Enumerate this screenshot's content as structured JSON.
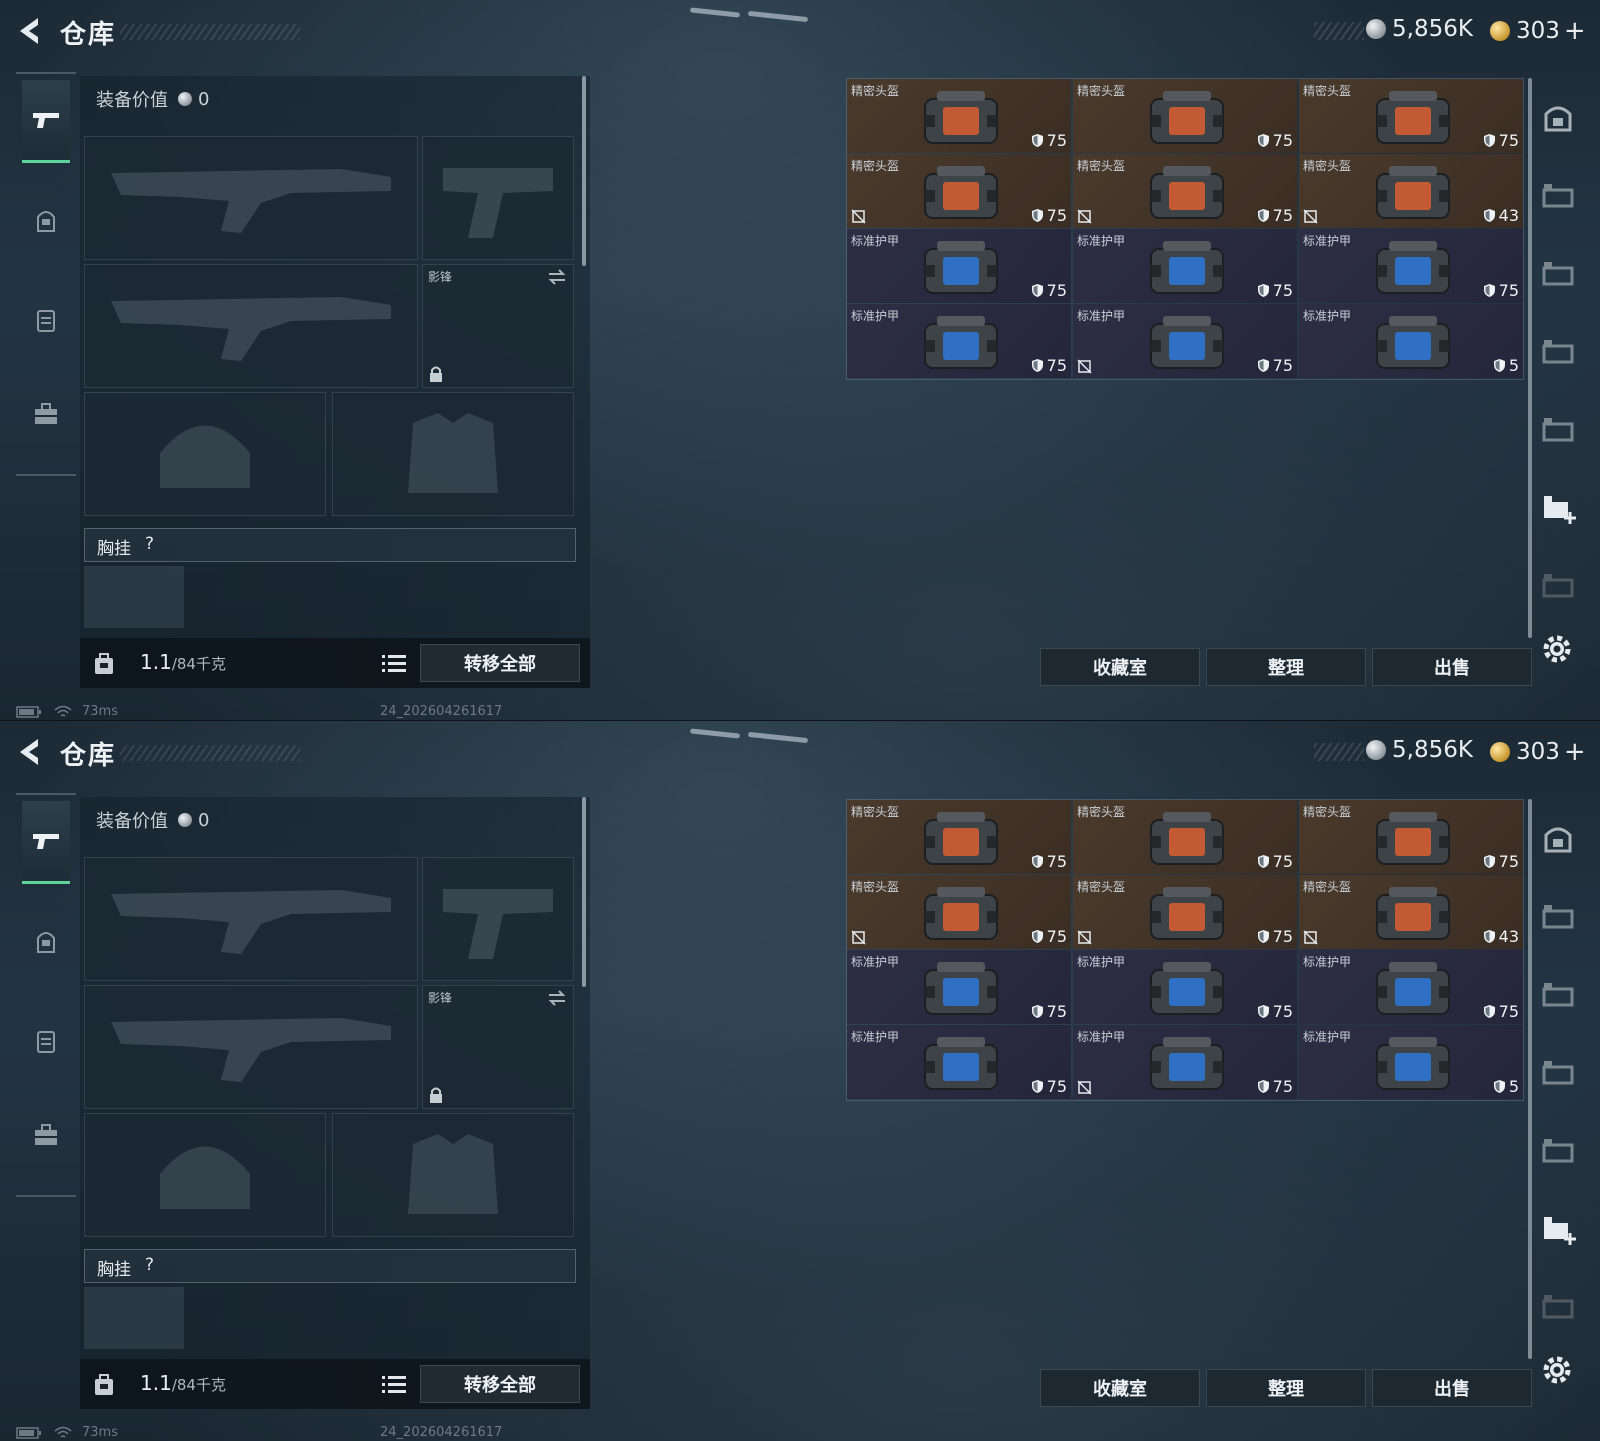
{
  "screens": [
    {
      "title": "仓库",
      "currency": {
        "silver": "5,856K",
        "gold": "303",
        "gold_plus": "+"
      },
      "equip": {
        "value_label": "装备价值",
        "value": "0",
        "slot_secondary_label": "影锋",
        "chest_label": "胸挂",
        "chest_help": "?",
        "weight_current": "1.1",
        "weight_max": "/84千克",
        "transfer_all": "转移全部"
      },
      "items": [
        {
          "name": "精密头盔",
          "value": "75",
          "type": "helmet",
          "flag": false
        },
        {
          "name": "精密头盔",
          "value": "75",
          "type": "helmet",
          "flag": false
        },
        {
          "name": "精密头盔",
          "value": "75",
          "type": "helmet",
          "flag": false
        },
        {
          "name": "精密头盔",
          "value": "75",
          "type": "helmet",
          "flag": true
        },
        {
          "name": "精密头盔",
          "value": "75",
          "type": "helmet",
          "flag": true
        },
        {
          "name": "精密头盔",
          "value": "43",
          "type": "helmet",
          "flag": true
        },
        {
          "name": "标准护甲",
          "value": "75",
          "type": "armor",
          "flag": false
        },
        {
          "name": "标准护甲",
          "value": "75",
          "type": "armor",
          "flag": false
        },
        {
          "name": "标准护甲",
          "value": "75",
          "type": "armor",
          "flag": false
        },
        {
          "name": "标准护甲",
          "value": "75",
          "type": "armor",
          "flag": false
        },
        {
          "name": "标准护甲",
          "value": "75",
          "type": "armor",
          "flag": true
        },
        {
          "name": "标准护甲",
          "value": "5",
          "type": "armor",
          "flag": false
        }
      ],
      "actions": {
        "collection": "收藏室",
        "sort": "整理",
        "sell": "出售"
      },
      "status": {
        "ping": "73ms",
        "build": "24_202604261617"
      }
    },
    {
      "title": "仓库",
      "currency": {
        "silver": "5,856K",
        "gold": "303",
        "gold_plus": "+"
      },
      "equip": {
        "value_label": "装备价值",
        "value": "0",
        "slot_secondary_label": "影锋",
        "chest_label": "胸挂",
        "chest_help": "?",
        "weight_current": "1.1",
        "weight_max": "/84千克",
        "transfer_all": "转移全部"
      },
      "items": [
        {
          "name": "精密头盔",
          "value": "75",
          "type": "helmet",
          "flag": false
        },
        {
          "name": "精密头盔",
          "value": "75",
          "type": "helmet",
          "flag": false
        },
        {
          "name": "精密头盔",
          "value": "75",
          "type": "helmet",
          "flag": false
        },
        {
          "name": "精密头盔",
          "value": "75",
          "type": "helmet",
          "flag": true
        },
        {
          "name": "精密头盔",
          "value": "75",
          "type": "helmet",
          "flag": true
        },
        {
          "name": "精密头盔",
          "value": "43",
          "type": "helmet",
          "flag": true
        },
        {
          "name": "标准护甲",
          "value": "75",
          "type": "armor",
          "flag": false
        },
        {
          "name": "标准护甲",
          "value": "75",
          "type": "armor",
          "flag": false
        },
        {
          "name": "标准护甲",
          "value": "75",
          "type": "armor",
          "flag": false
        },
        {
          "name": "标准护甲",
          "value": "75",
          "type": "armor",
          "flag": false
        },
        {
          "name": "标准护甲",
          "value": "75",
          "type": "armor",
          "flag": true
        },
        {
          "name": "标准护甲",
          "value": "5",
          "type": "armor",
          "flag": false
        }
      ],
      "actions": {
        "collection": "收藏室",
        "sort": "整理",
        "sell": "出售"
      },
      "status": {
        "ping": "73ms",
        "build": "24_202604261617"
      }
    }
  ],
  "colors": {
    "accent": "#5fd39a",
    "helmet_bg": "#4a3a2c",
    "armor_bg": "#2d2e44"
  }
}
